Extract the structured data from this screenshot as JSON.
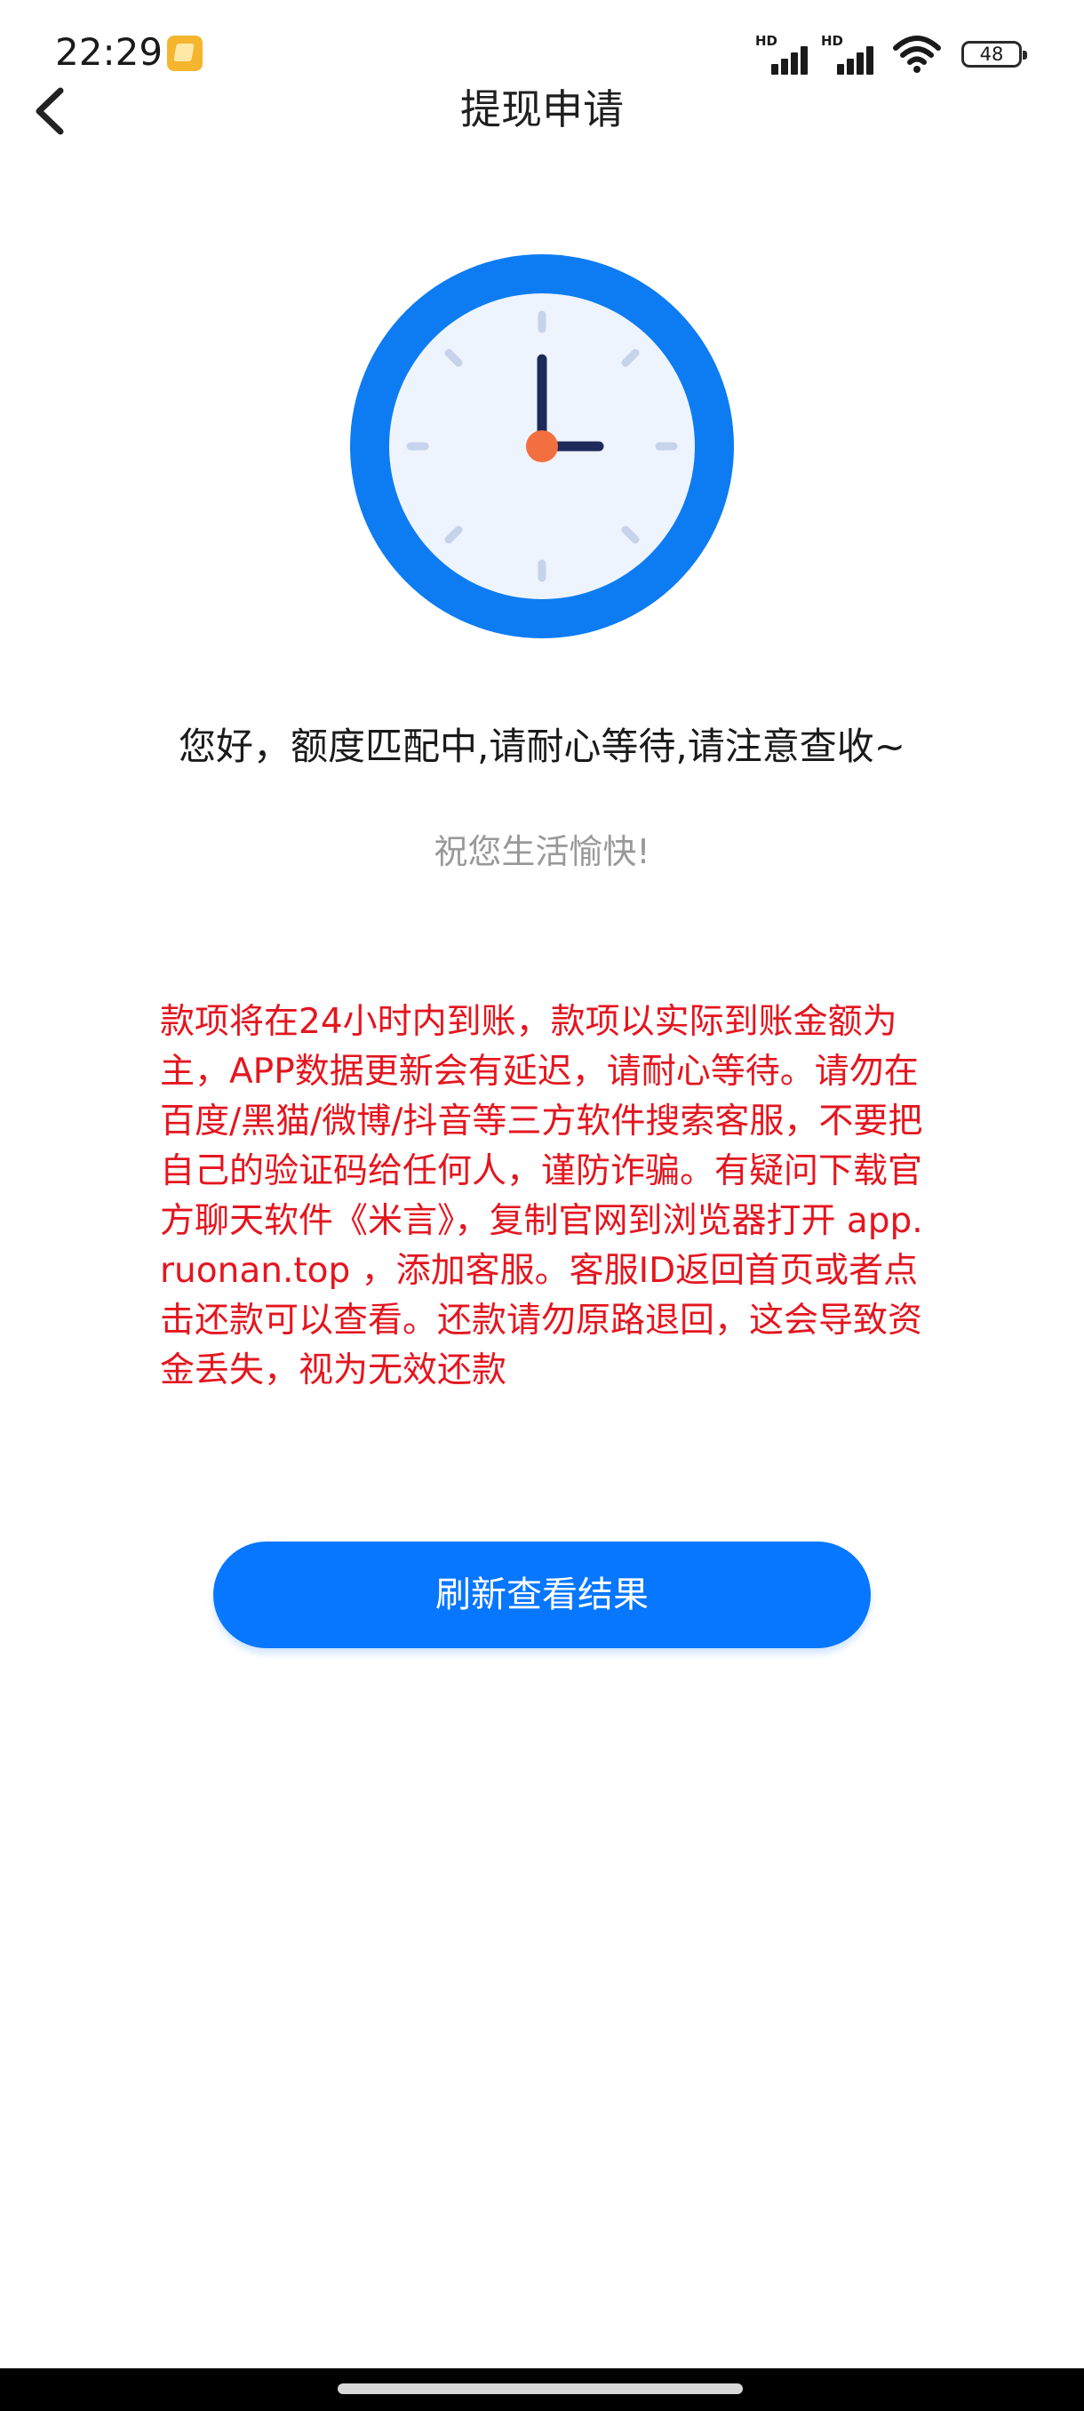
{
  "status_bar": {
    "time": "22:29",
    "signal_1_label": "HD",
    "signal_2_label": "HD",
    "battery_level": "48",
    "icons": [
      "app-notification-icon",
      "signal-icon",
      "signal-icon",
      "wifi-icon",
      "battery-icon"
    ]
  },
  "nav": {
    "title": "提现申请",
    "back_icon": "chevron-left-icon"
  },
  "illustration": {
    "icon": "clock-icon",
    "colors": {
      "ring": "#0d7cf2",
      "face": "#eef4fd",
      "hands": "#1e2a5a",
      "center": "#f36f3f",
      "ticks": "#c7d3ea"
    }
  },
  "message": {
    "headline": "您好，额度匹配中,请耐心等待,请注意查收~",
    "subline": "祝您生活愉快!",
    "notice": "款项将在24小时内到账，款项以实际到账金额为主，APP数据更新会有延迟，请耐心等待。请勿在百度/黑猫/微博/抖音等三方软件搜索客服，不要把自己的验证码给任何人，谨防诈骗。有疑问下载官方聊天软件《米言》，复制官网到浏览器打开 app.ruonan.top ，添加客服。客服ID返回首页或者点击还款可以查看。还款请勿原路退回，这会导致资金丢失，视为无效还款"
  },
  "actions": {
    "refresh_label": "刷新查看结果"
  },
  "colors": {
    "accent": "#0877ff",
    "notice_text": "#e4161f",
    "subtle_text": "#999999"
  }
}
